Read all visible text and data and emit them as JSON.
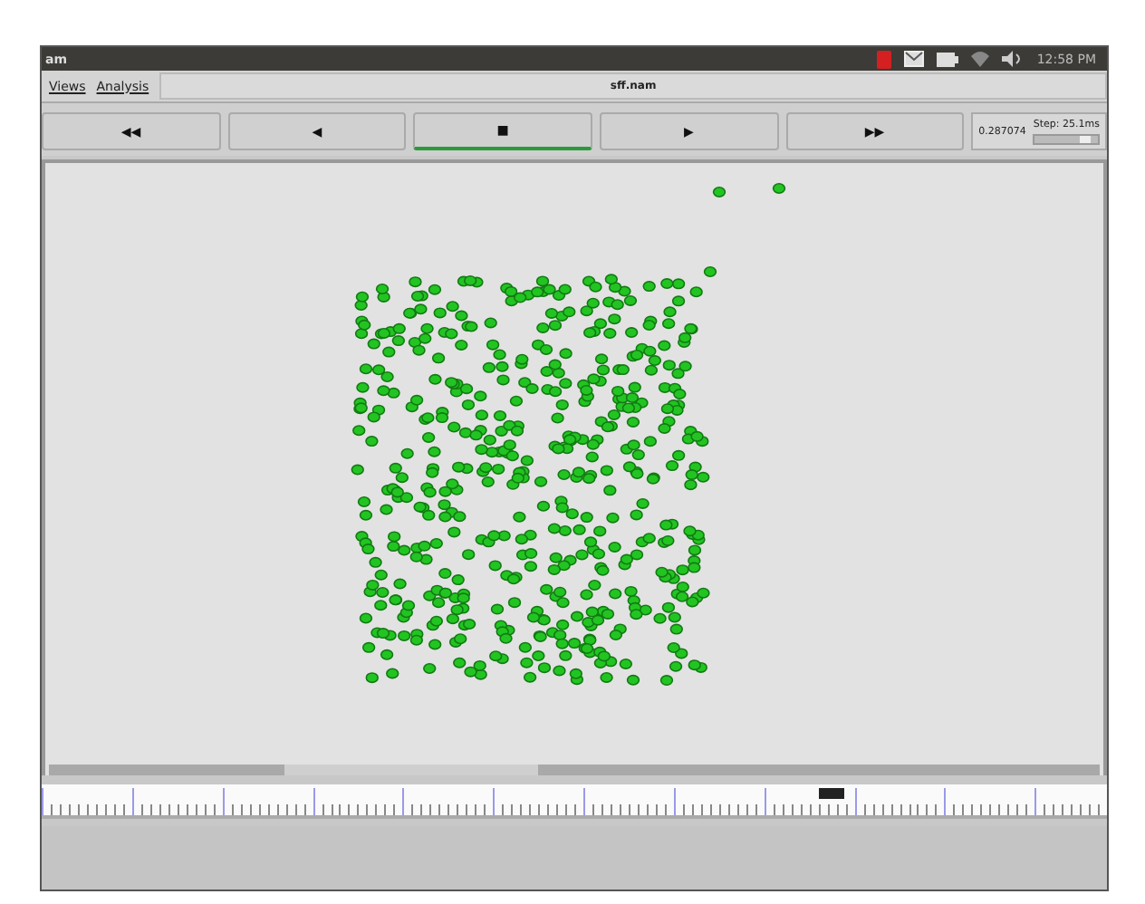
{
  "top_bar": {
    "app_name": "am",
    "clock": "12:58 PM"
  },
  "menu": {
    "items": [
      "Views",
      "Analysis"
    ],
    "file_title": "sff.nam"
  },
  "controls": [
    {
      "glyph": "◀◀",
      "selected": false
    },
    {
      "glyph": "◀",
      "selected": false
    },
    {
      "glyph": "■",
      "selected": true
    },
    {
      "glyph": "▶",
      "selected": false
    },
    {
      "glyph": "▶▶",
      "selected": false
    }
  ],
  "time": "0.287074",
  "step": {
    "label": "Step: 25.1ms",
    "level": 0.85
  },
  "timeline": {
    "level": 0.73
  }
}
